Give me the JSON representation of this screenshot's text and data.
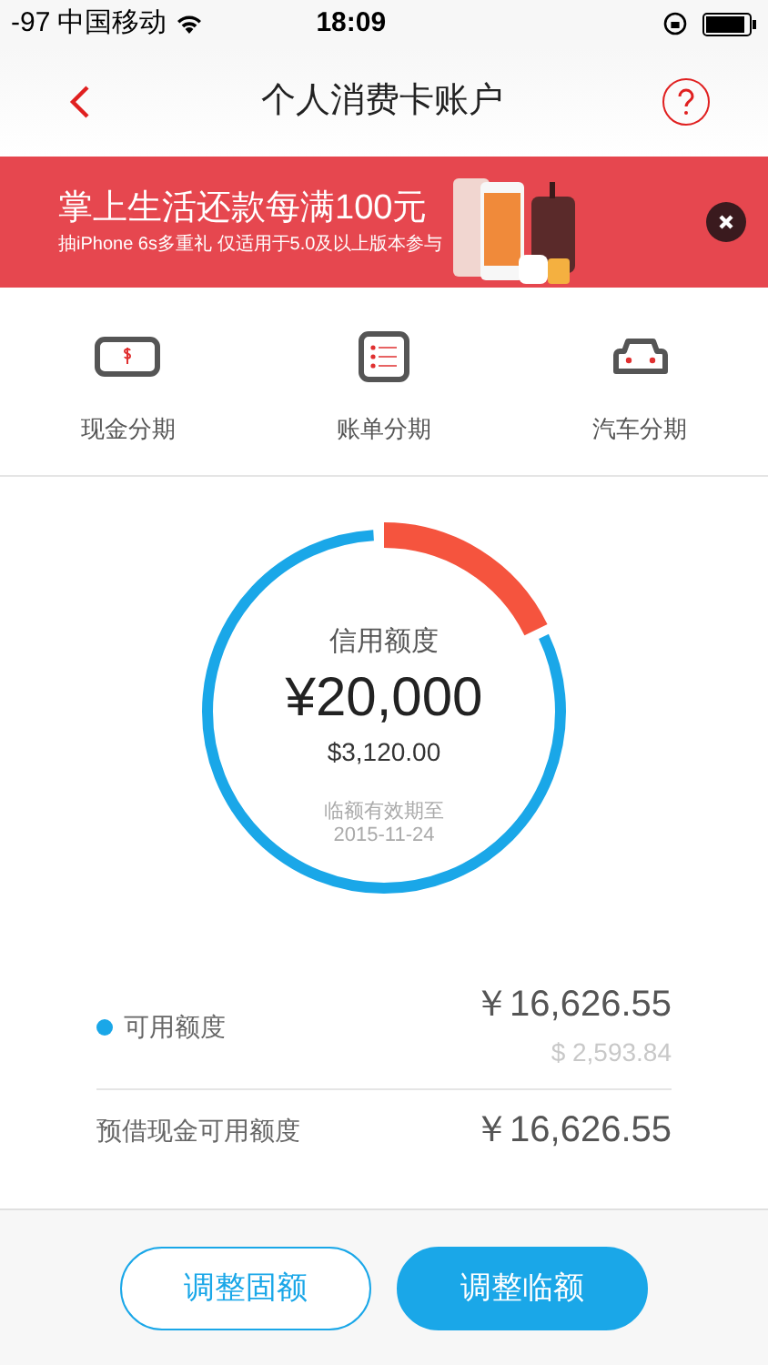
{
  "status_bar": {
    "signal": "-97",
    "carrier": "中国移动",
    "time": "18:09"
  },
  "nav": {
    "title": "个人消费卡账户"
  },
  "banner": {
    "headline": "掌上生活还款每满100元",
    "subline": "抽iPhone 6s多重礼 仅适用于5.0及以上版本参与"
  },
  "shortcuts": [
    {
      "kind": "cash",
      "label": "现金分期"
    },
    {
      "kind": "bill",
      "label": "账单分期"
    },
    {
      "kind": "car",
      "label": "汽车分期"
    }
  ],
  "credit": {
    "label": "信用额度",
    "amount": "¥20,000",
    "usd": "$3,120.00",
    "expiry_label": "临额有效期至",
    "expiry_date": "2015-11-24",
    "level": 0.17
  },
  "rows": [
    {
      "label": "可用额度",
      "dot": true,
      "cny": "￥16,626.55",
      "usd": "$ 2,593.84"
    },
    {
      "label": "预借现金可用额度",
      "dot": false,
      "cny": "￥16,626.55"
    }
  ],
  "buttons": [
    {
      "kind": "outline",
      "label": "调整固额"
    },
    {
      "kind": "solid",
      "label": "调整临额"
    }
  ]
}
